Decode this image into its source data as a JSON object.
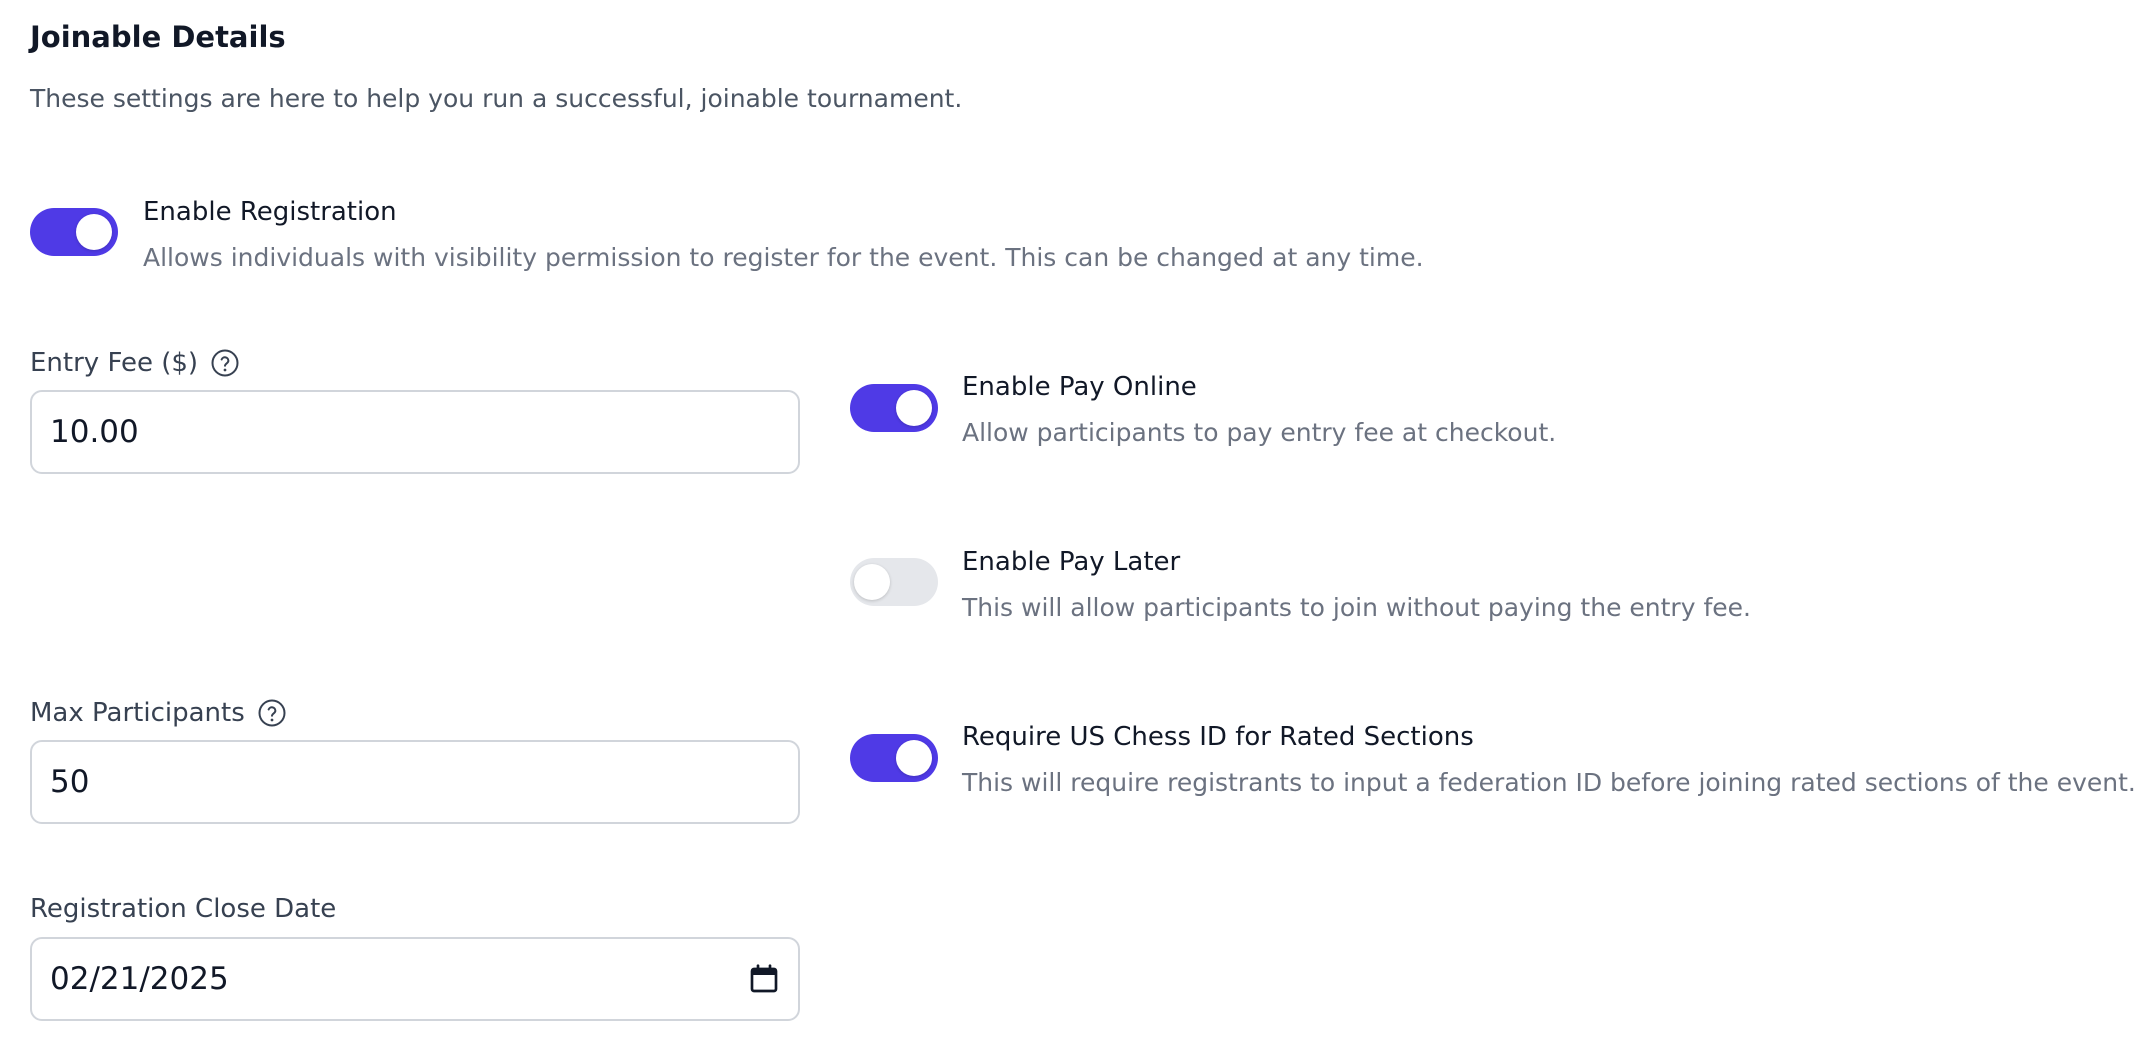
{
  "header": {
    "title": "Joinable Details",
    "subtitle": "These settings are here to help you run a successful, joinable tournament."
  },
  "toggles": {
    "registration": {
      "label": "Enable Registration",
      "description": "Allows individuals with visibility permission to register for the event. This can be changed at any time.",
      "enabled": true
    },
    "pay_online": {
      "label": "Enable Pay Online",
      "description": "Allow participants to pay entry fee at checkout.",
      "enabled": true
    },
    "pay_later": {
      "label": "Enable Pay Later",
      "description": "This will allow participants to join without paying the entry fee.",
      "enabled": false
    },
    "us_chess_id": {
      "label": "Require US Chess ID for Rated Sections",
      "description": "This will require registrants to input a federation ID before joining rated sections of the event.",
      "enabled": true
    }
  },
  "fields": {
    "entry_fee": {
      "label": "Entry Fee ($)",
      "value": "10.00"
    },
    "max_participants": {
      "label": "Max Participants",
      "value": "50"
    },
    "close_date": {
      "label": "Registration Close Date",
      "value": "02/21/2025"
    }
  },
  "colors": {
    "accent": "#4f3ae6",
    "toggle_off": "#e5e7eb",
    "text_primary": "#111827",
    "text_secondary": "#6b7280",
    "border": "#d1d5db"
  },
  "icons": {
    "help": "question-circle-icon",
    "calendar": "calendar-icon"
  }
}
